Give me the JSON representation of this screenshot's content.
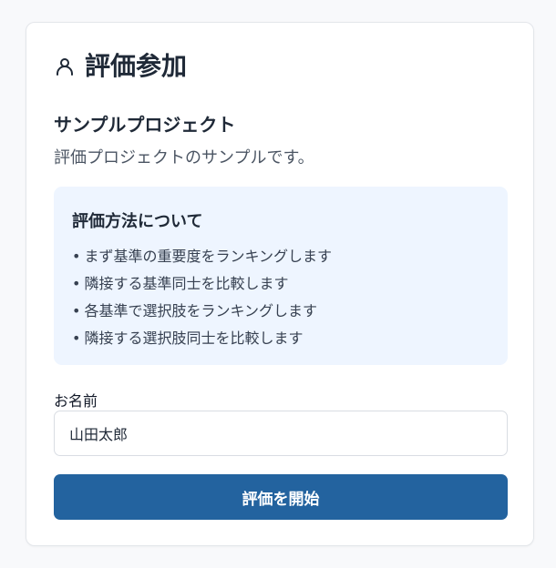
{
  "header": {
    "icon": "user-icon",
    "title": "評価参加"
  },
  "project": {
    "title": "サンプルプロジェクト",
    "description": "評価プロジェクトのサンプルです。"
  },
  "info": {
    "title": "評価方法について",
    "items": [
      "まず基準の重要度をランキングします",
      "隣接する基準同士を比較します",
      "各基準で選択肢をランキングします",
      "隣接する選択肢同士を比較します"
    ]
  },
  "form": {
    "name_label": "お名前",
    "name_value": "山田太郎",
    "submit_label": "評価を開始"
  },
  "colors": {
    "accent": "#23639f",
    "info_bg": "#eef5ff"
  }
}
